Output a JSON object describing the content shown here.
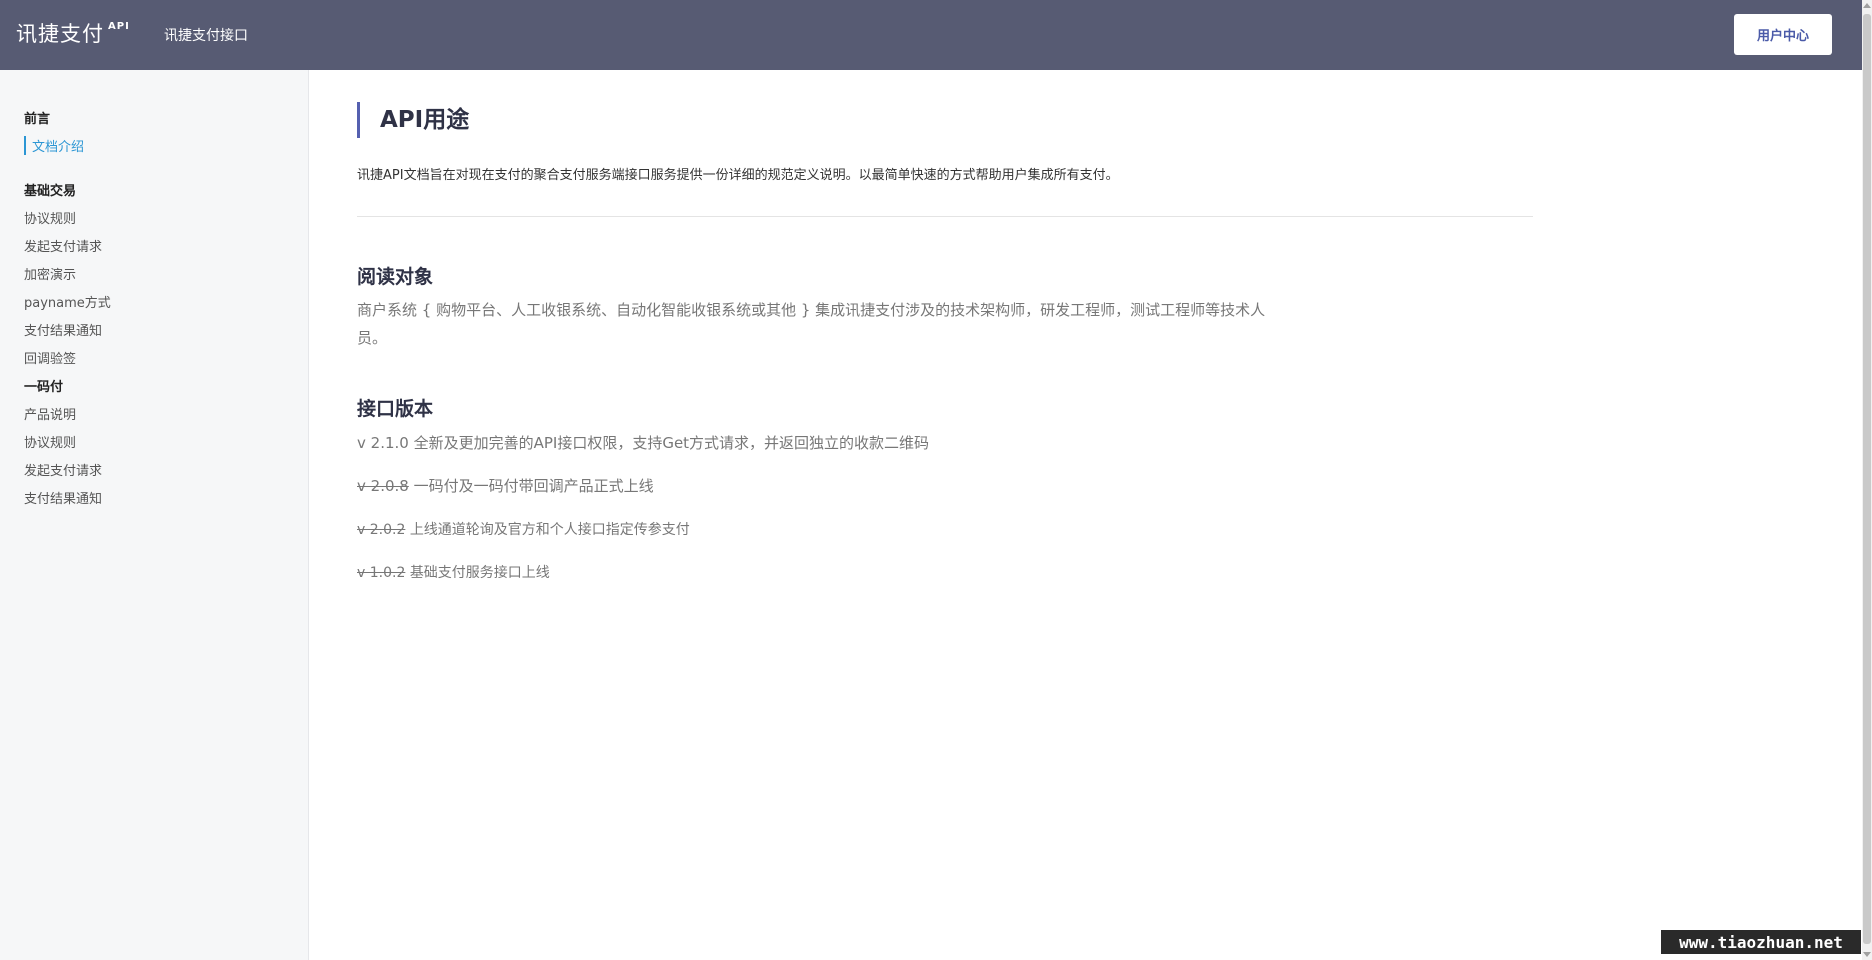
{
  "header": {
    "brand": "讯捷支付",
    "brand_sup": "API",
    "link": "讯捷支付接口",
    "user_button": "用户中心"
  },
  "sidebar": {
    "groups": [
      {
        "title": "前言",
        "items": [
          {
            "label": "文档介绍",
            "active": true
          }
        ]
      },
      {
        "title": "基础交易",
        "items": [
          {
            "label": "协议规则"
          },
          {
            "label": "发起支付请求"
          },
          {
            "label": "加密演示"
          },
          {
            "label": "payname方式"
          },
          {
            "label": "支付结果通知"
          },
          {
            "label": "回调验签"
          }
        ]
      },
      {
        "title": "一码付",
        "items": [
          {
            "label": "产品说明"
          },
          {
            "label": "协议规则"
          },
          {
            "label": "发起支付请求"
          },
          {
            "label": "支付结果通知"
          }
        ]
      }
    ]
  },
  "main": {
    "title": "API用途",
    "intro": "讯捷API文档旨在对现在支付的聚合支付服务端接口服务提供一份详细的规范定义说明。以最简单快速的方式帮助用户集成所有支付。",
    "readers_title": "阅读对象",
    "readers_text": "商户系统 { 购物平台、人工收银系统、自动化智能收银系统或其他 } 集成讯捷支付涉及的技术架构师，研发工程师，测试工程师等技术人员。",
    "versions_title": "接口版本",
    "versions": [
      {
        "version": "v 2.1.0",
        "desc": "全新及更加完善的API接口权限，支持Get方式请求，并返回独立的收款二维码",
        "deprecated": false
      },
      {
        "version": "v 2.0.8",
        "desc": "一码付及一码付带回调产品正式上线",
        "deprecated": true
      },
      {
        "version": "v 2.0.2",
        "desc": "上线通道轮询及官方和个人接口指定传参支付",
        "deprecated": true
      },
      {
        "version": "v 1.0.2",
        "desc": "基础支付服务接口上线",
        "deprecated": true
      }
    ]
  },
  "watermark": "www.tiaozhuan.net"
}
